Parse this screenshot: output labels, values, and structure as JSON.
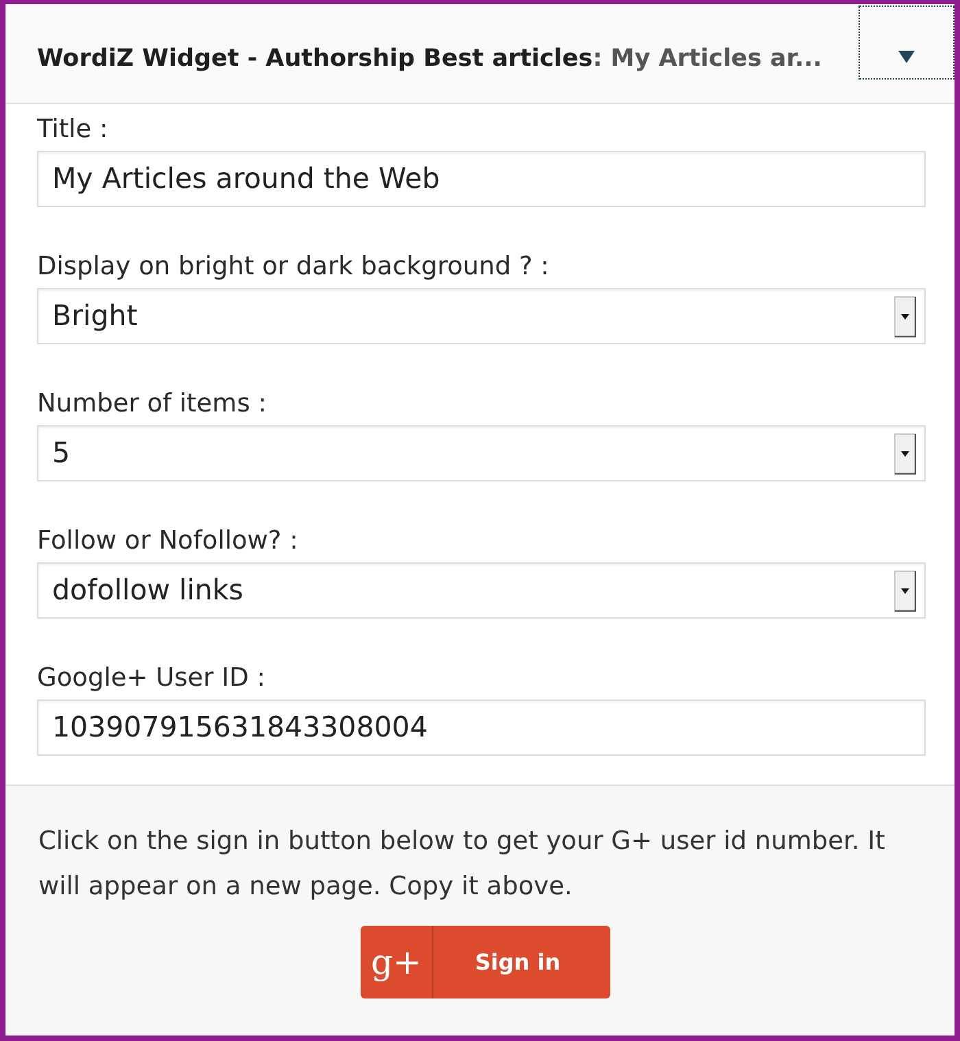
{
  "widget": {
    "title": "WordiZ Widget - Authorship Best articles",
    "subtitle": ": My Articles ar..."
  },
  "fields": [
    {
      "kind": "text",
      "label": "Title :",
      "value": "My Articles around the Web"
    },
    {
      "kind": "select",
      "label": "Display on bright or dark background ? :",
      "value": "Bright"
    },
    {
      "kind": "select",
      "label": "Number of items :",
      "value": "5"
    },
    {
      "kind": "select",
      "label": "Follow or Nofollow? :",
      "value": "dofollow links"
    },
    {
      "kind": "text",
      "label": "Google+ User ID :",
      "value": "103907915631843308004"
    }
  ],
  "signin": {
    "text": "Click on the sign in button below to get your G+ user id number. It will appear on a new page. Copy it above.",
    "logo": "g+",
    "button": "Sign in"
  }
}
